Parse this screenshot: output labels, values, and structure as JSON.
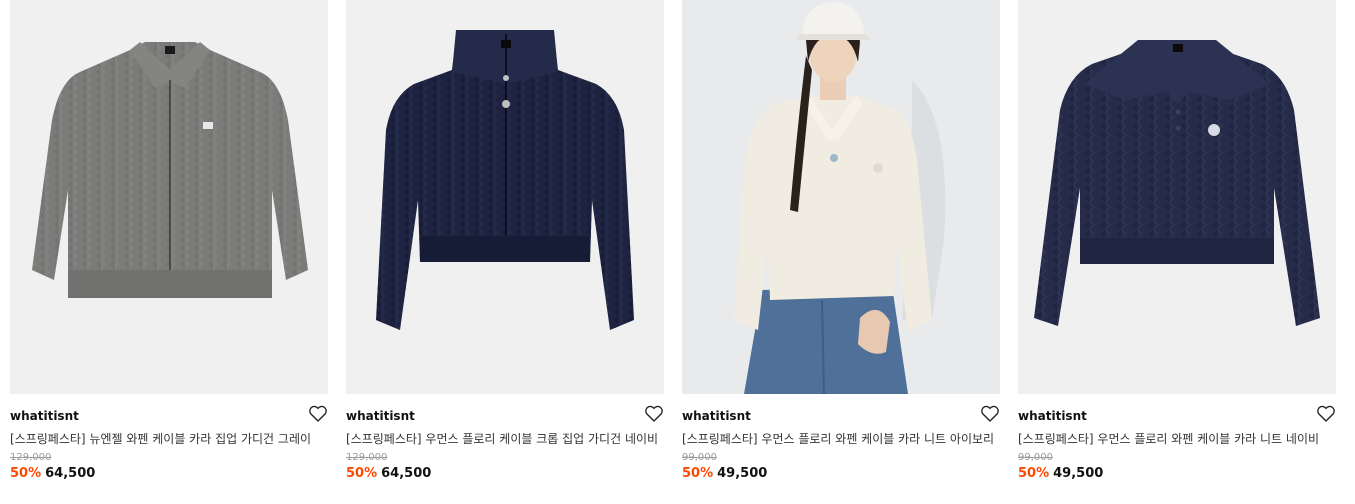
{
  "products": [
    {
      "brand": "whatitisnt",
      "title": "[스프링페스타] 뉴엔젤 와펜 케이블 카라 집업 가디건 그레이",
      "original_price": "129,000",
      "discount": "50%",
      "price": "64,500",
      "image_icon": "grey-cable-zip-cardigan",
      "bg": "#f0f0f0",
      "knit_color": "#7b7c7a"
    },
    {
      "brand": "whatitisnt",
      "title": "[스프링페스타] 우먼스 플로리 케이블 크롭 집업 가디건 네이비",
      "original_price": "129,000",
      "discount": "50%",
      "price": "64,500",
      "image_icon": "navy-crop-zip-cardigan",
      "bg": "#f0f0f0",
      "knit_color": "#1d2340"
    },
    {
      "brand": "whatitisnt",
      "title": "[스프링페스타] 우먼스 플로리 와펜 케이블 카라 니트 아이보리",
      "original_price": "99,000",
      "discount": "50%",
      "price": "49,500",
      "image_icon": "model-ivory-knit-photo",
      "bg": "#e9eaec",
      "knit_color": "#f1ece2"
    },
    {
      "brand": "whatitisnt",
      "title": "[스프링페스타] 우먼스 플로리 와펜 케이블 카라 니트 네이비",
      "original_price": "99,000",
      "discount": "50%",
      "price": "49,500",
      "image_icon": "navy-collar-knit",
      "bg": "#f0f0f0",
      "knit_color": "#252b48"
    }
  ],
  "colors": {
    "discount": "#ff4800",
    "text": "#111111",
    "muted": "#9a9a9a"
  },
  "icons": {
    "wishlist": "heart-outline-icon"
  }
}
